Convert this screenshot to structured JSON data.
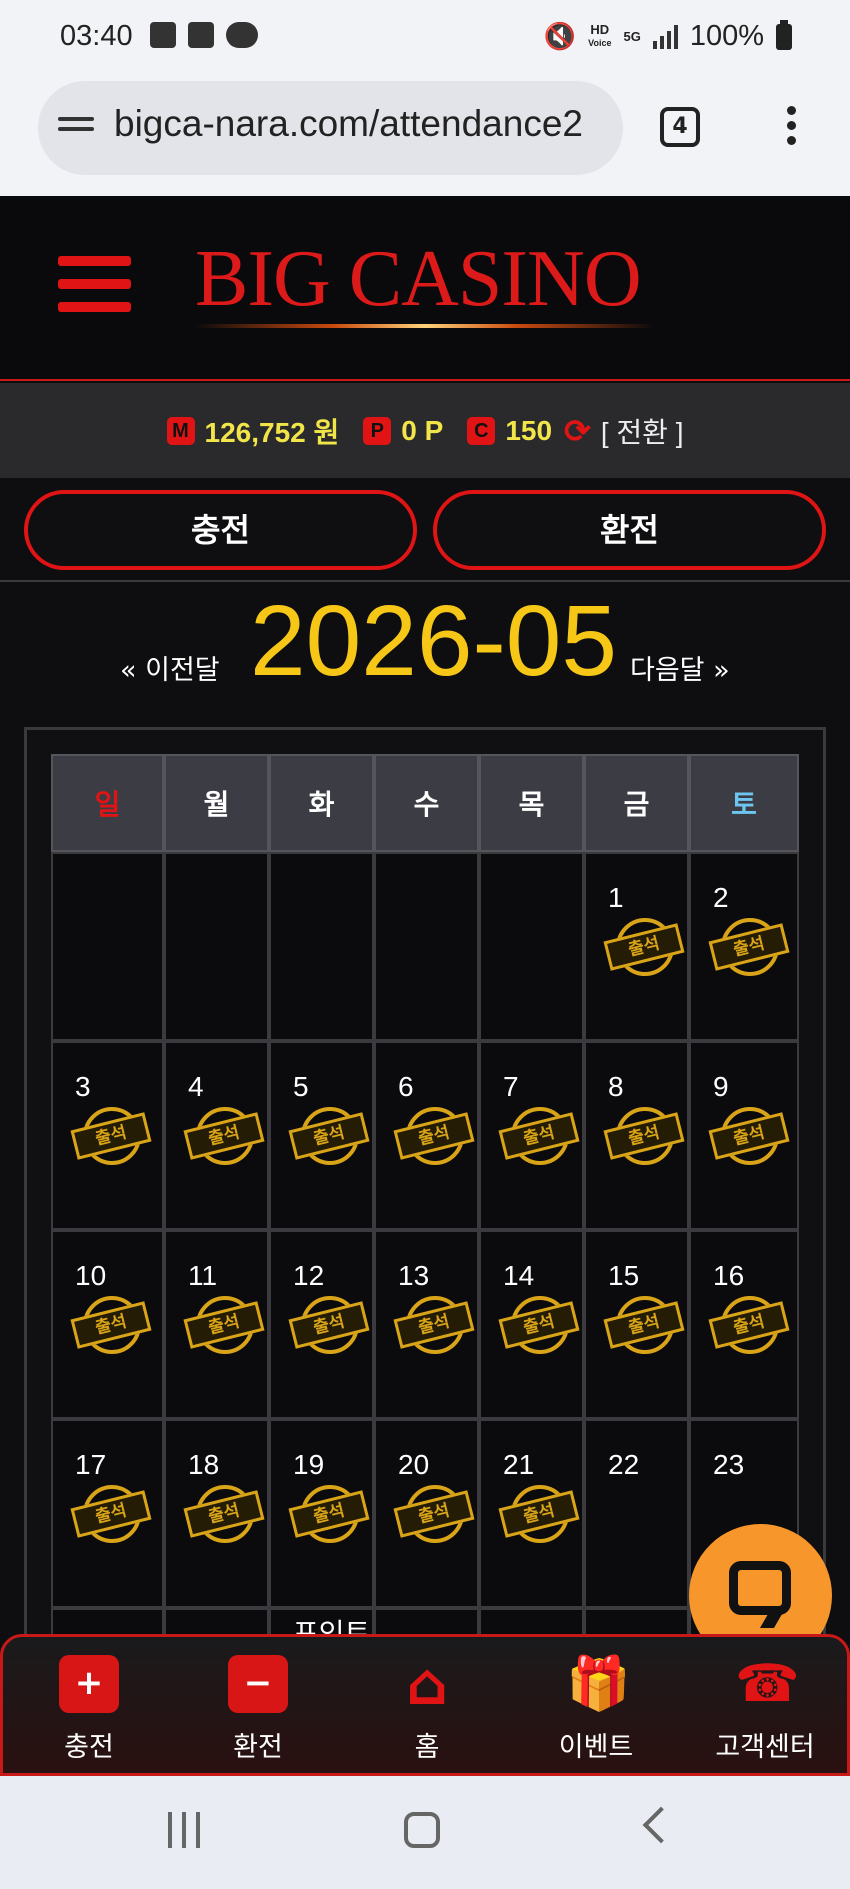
{
  "status_bar": {
    "time": "03:40",
    "hd_label": "HD",
    "voice_label": "Voice",
    "network": "5G",
    "battery": "100%"
  },
  "browser": {
    "url": "bigca-nara.com/attendance2",
    "tab_count": "4"
  },
  "site": {
    "logo": "BIG CASINO"
  },
  "balance": {
    "money_badge": "M",
    "money": "126,752 원",
    "point_badge": "P",
    "points": "0 P",
    "coin_badge": "C",
    "coins": "150",
    "switch_label": "[ 전환 ]"
  },
  "buttons": {
    "charge": "충전",
    "exchange": "환전"
  },
  "calendar": {
    "prev_label": "« 이전달",
    "month": "2026-05",
    "next_label": "다음달 »",
    "stamp_label": "출석",
    "weekdays": [
      "일",
      "월",
      "화",
      "수",
      "목",
      "금",
      "토"
    ],
    "weeks": [
      [
        {
          "day": "",
          "attended": false
        },
        {
          "day": "",
          "attended": false
        },
        {
          "day": "",
          "attended": false
        },
        {
          "day": "",
          "attended": false
        },
        {
          "day": "",
          "attended": false
        },
        {
          "day": "1",
          "attended": true
        },
        {
          "day": "2",
          "attended": true
        }
      ],
      [
        {
          "day": "3",
          "attended": true
        },
        {
          "day": "4",
          "attended": true
        },
        {
          "day": "5",
          "attended": true
        },
        {
          "day": "6",
          "attended": true
        },
        {
          "day": "7",
          "attended": true
        },
        {
          "day": "8",
          "attended": true
        },
        {
          "day": "9",
          "attended": true
        }
      ],
      [
        {
          "day": "10",
          "attended": true
        },
        {
          "day": "11",
          "attended": true
        },
        {
          "day": "12",
          "attended": true
        },
        {
          "day": "13",
          "attended": true
        },
        {
          "day": "14",
          "attended": true
        },
        {
          "day": "15",
          "attended": true
        },
        {
          "day": "16",
          "attended": true
        }
      ],
      [
        {
          "day": "17",
          "attended": true
        },
        {
          "day": "18",
          "attended": true
        },
        {
          "day": "19",
          "attended": true
        },
        {
          "day": "20",
          "attended": true
        },
        {
          "day": "21",
          "attended": true
        },
        {
          "day": "22",
          "attended": false
        },
        {
          "day": "23",
          "attended": false
        }
      ],
      [
        {
          "day": "",
          "attended": false
        },
        {
          "day": "",
          "attended": false
        },
        {
          "day": "포인트",
          "attended": false
        },
        {
          "day": "",
          "attended": false
        },
        {
          "day": "",
          "attended": false
        },
        {
          "day": "",
          "attended": false
        },
        {
          "day": "",
          "attended": false
        }
      ]
    ]
  },
  "bottom_nav": [
    {
      "label": "충전",
      "icon": "plus-icon",
      "glyph": "+"
    },
    {
      "label": "환전",
      "icon": "minus-icon",
      "glyph": "−"
    },
    {
      "label": "홈",
      "icon": "home-icon",
      "glyph": "⌂"
    },
    {
      "label": "이벤트",
      "icon": "gift-icon",
      "glyph": "🎁"
    },
    {
      "label": "고객센터",
      "icon": "phone-icon",
      "glyph": "☎"
    }
  ],
  "colors": {
    "accent_red": "#e01414",
    "gold": "#f7c717",
    "balance_yellow": "#f2e54a",
    "chat_orange": "#f7962a"
  }
}
